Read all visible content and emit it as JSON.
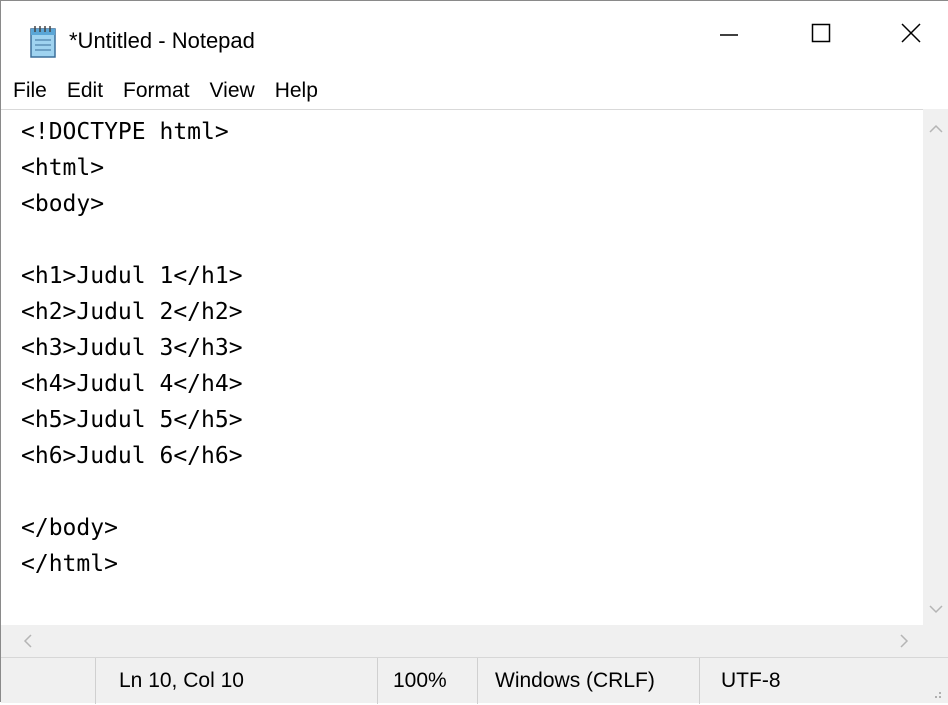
{
  "window": {
    "title": "*Untitled - Notepad",
    "app_icon": "notepad-icon",
    "controls": {
      "minimize_icon": "minimize-icon",
      "maximize_icon": "maximize-icon",
      "close_icon": "close-icon"
    }
  },
  "menubar": {
    "items": [
      {
        "label": "File"
      },
      {
        "label": "Edit"
      },
      {
        "label": "Format"
      },
      {
        "label": "View"
      },
      {
        "label": "Help"
      }
    ]
  },
  "editor": {
    "lines": [
      "<!DOCTYPE html>",
      "<html>",
      "<body>",
      "",
      "<h1>Judul 1</h1>",
      "<h2>Judul 2</h2>",
      "<h3>Judul 3</h3>",
      "<h4>Judul 4</h4>",
      "<h5>Judul 5</h5>",
      "<h6>Judul 6</h6>",
      "",
      "</body>",
      "</html>"
    ]
  },
  "statusbar": {
    "position": "Ln 10, Col 10",
    "zoom": "100%",
    "line_ending": "Windows (CRLF)",
    "encoding": "UTF-8"
  },
  "colors": {
    "chrome_bg": "#f0f0f0",
    "editor_bg": "#ffffff",
    "text": "#000000"
  }
}
